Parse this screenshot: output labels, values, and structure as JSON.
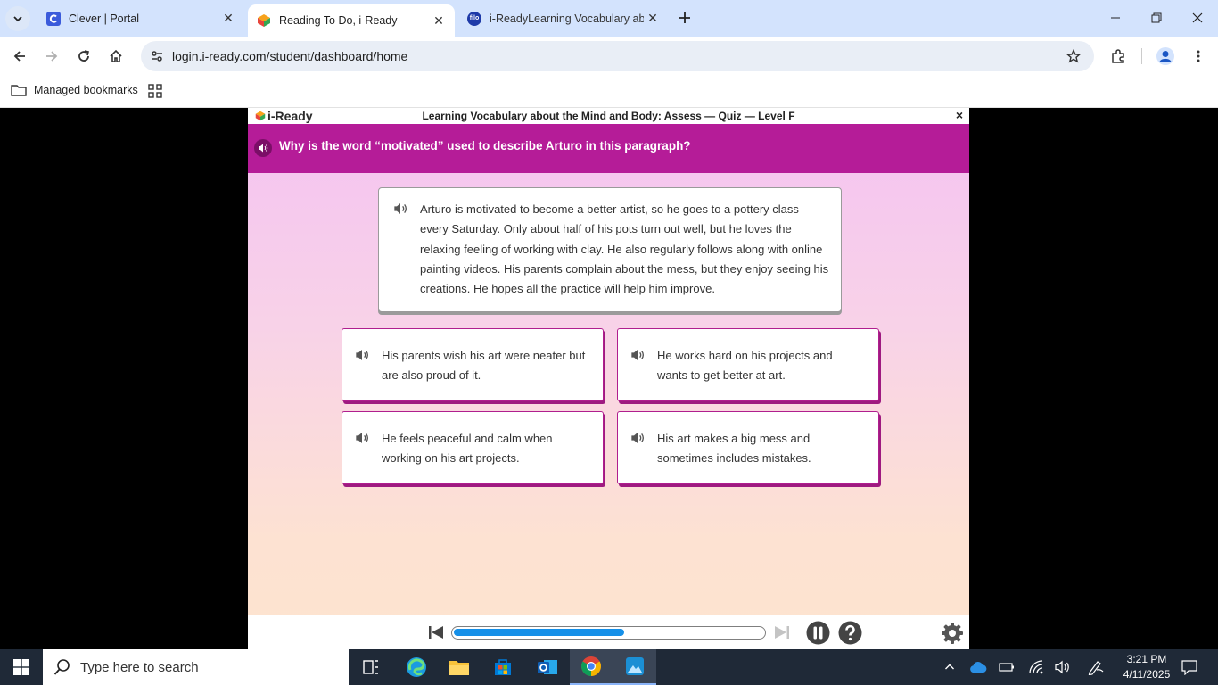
{
  "browser": {
    "tabs": [
      {
        "title": "Clever | Portal",
        "active": false,
        "favicon": "clever-icon"
      },
      {
        "title": "Reading To Do, i-Ready",
        "active": true,
        "favicon": "iready-icon"
      },
      {
        "title": "i-ReadyLearning Vocabulary ab",
        "active": false,
        "favicon": "filo-icon"
      }
    ],
    "url": "login.i-ready.com/student/dashboard/home",
    "bookmarks_label": "Managed bookmarks"
  },
  "quiz": {
    "logo": "i-Ready",
    "lesson_title": "Learning Vocabulary about the Mind and Body: Assess — Quiz — Level F",
    "close_symbol": "×",
    "question": "Why is the word “motivated” used to describe Arturo in this paragraph?",
    "passage": "Arturo is motivated to become a better artist, so he goes to a pottery class every Saturday. Only about half of his pots turn out well, but he loves the relaxing feeling of working with clay. He also regularly follows along with online painting videos. His parents complain about the mess, but they enjoy seeing his creations. He hopes all the practice will help him improve.",
    "choices": [
      "His parents wish his art were neater but are also proud of it.",
      "He works hard on his projects and wants to get better at art.",
      "He feels peaceful and calm when working on his art projects.",
      "His art makes a big mess and sometimes includes mistakes."
    ],
    "progress": 0.55,
    "colors": {
      "question_bar": "#b51c98",
      "progress_fill": "#1690e8",
      "choice_border": "#b01e8e"
    }
  },
  "taskbar": {
    "search_placeholder": "Type here to search",
    "time": "3:21 PM",
    "date": "4/11/2025"
  }
}
